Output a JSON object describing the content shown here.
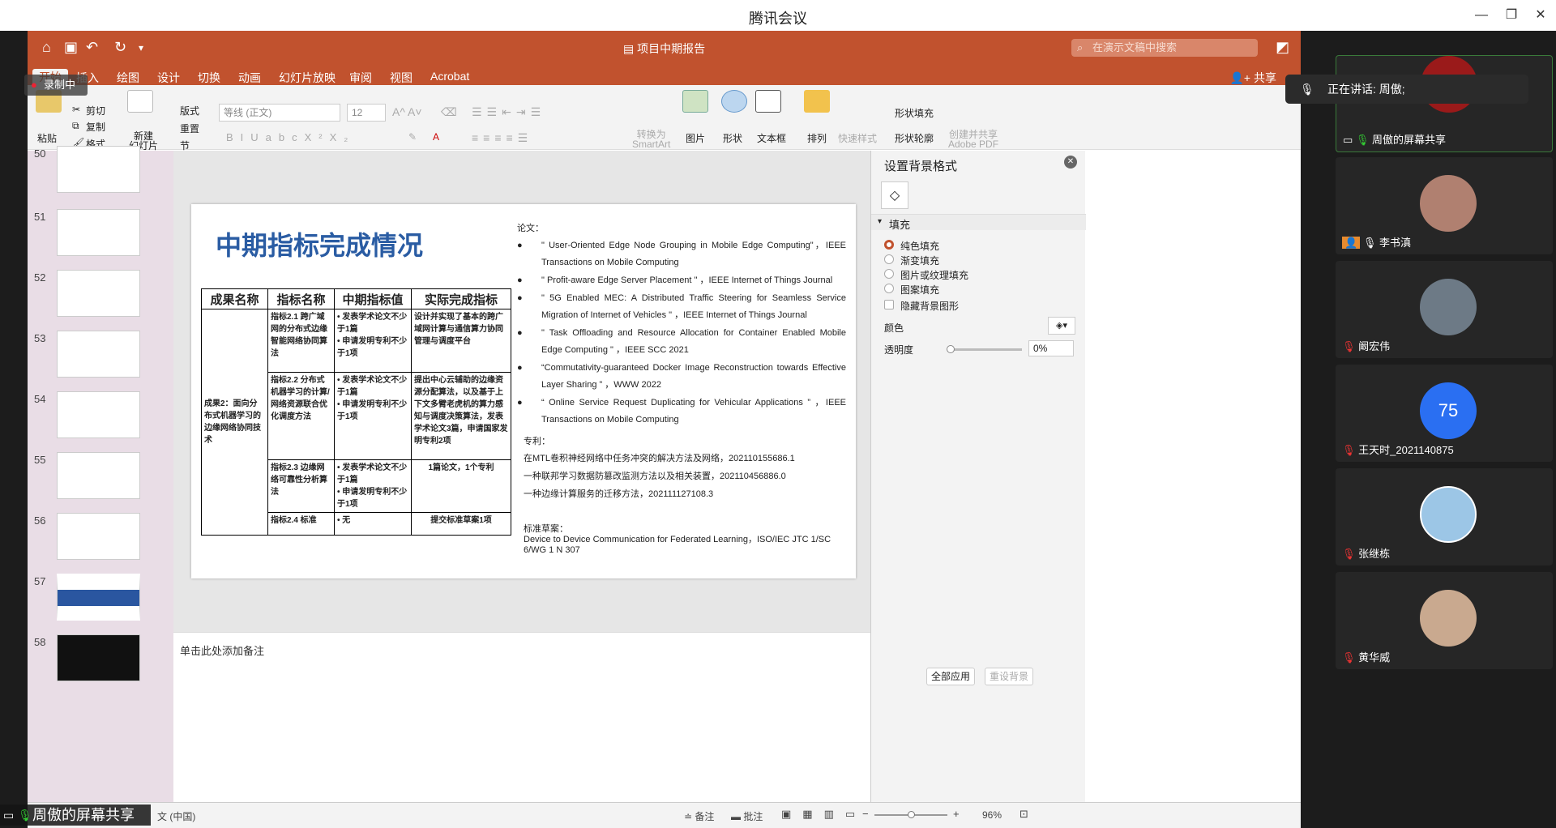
{
  "app": {
    "title": "腾讯会议"
  },
  "ppt": {
    "doc_title": "项目中期报告",
    "search_placeholder": "在演示文稿中搜索",
    "tabs": [
      "开始",
      "插入",
      "绘图",
      "设计",
      "切换",
      "动画",
      "幻灯片放映",
      "审阅",
      "视图",
      "Acrobat"
    ],
    "share_label": "共享",
    "ribbon": {
      "paste": "粘贴",
      "cut": "剪切",
      "copy": "复制",
      "format": "格式",
      "new_slide": "新建\n幻灯片",
      "layout": "版式",
      "reset": "重置",
      "section": "节",
      "font_name": "等线 (正文)",
      "font_size": "12",
      "convert_smartart": "转换为\nSmartArt",
      "picture": "图片",
      "shape": "形状",
      "textbox": "文本框",
      "arrange": "排列",
      "quick_style": "快速样式",
      "shape_fill": "形状填充",
      "shape_outline": "形状轮廓",
      "create_pdf": "创建并共享\nAdobe PDF"
    },
    "slides": [
      {
        "num": "50"
      },
      {
        "num": "51"
      },
      {
        "num": "52"
      },
      {
        "num": "53"
      },
      {
        "num": "54"
      },
      {
        "num": "55"
      },
      {
        "num": "56"
      },
      {
        "num": "57"
      },
      {
        "num": "58"
      }
    ],
    "slide": {
      "title": "中期指标完成情况",
      "table": {
        "headers": [
          "成果名称",
          "指标名称",
          "中期指标值",
          "实际完成指标"
        ],
        "outcome": "成果2：面向分布式机器学习的边缘网络协同技术",
        "rows": [
          {
            "name": "指标2.1 跨广域网的分布式边缘智能网络协同算法",
            "targets": [
              "发表学术论文不少于1篇",
              "申请发明专利不少于1项"
            ],
            "actual": "设计并实现了基本的跨广域网计算与通信算力协同管理与调度平台"
          },
          {
            "name": "指标2.2 分布式机器学习的计算/网络资源联合优化调度方法",
            "targets": [
              "发表学术论文不少于1篇",
              "申请发明专利不少于1项"
            ],
            "actual": "提出中心云辅助的边缘资源分配算法，以及基于上下文多臂老虎机的算力感知与调度决策算法，发表学术论文3篇，申请国家发明专利2项"
          },
          {
            "name": "指标2.3 边缘网络可靠性分析算法",
            "targets": [
              "发表学术论文不少于1篇",
              "申请发明专利不少于1项"
            ],
            "actual": "1篇论文，1个专利"
          },
          {
            "name": "指标2.4 标准",
            "targets": [
              "无"
            ],
            "actual": "提交标准草案1项"
          }
        ]
      },
      "papers_label": "论文：",
      "papers": [
        "\" User-Oriented Edge Node Grouping in Mobile Edge Computing\"，IEEE Transactions on Mobile Computing",
        "\" Profit-aware Edge Server Placement \" ，IEEE Internet of Things Journal",
        "\" 5G Enabled MEC: A Distributed Traffic Steering for Seamless Service Migration of Internet of Vehicles \" ，IEEE Internet of Things Journal",
        "\" Task Offloading and Resource Allocation for Container Enabled Mobile Edge Computing \" ，IEEE SCC 2021",
        "“Commutativity-guaranteed Docker Image Reconstruction towards Effective Layer Sharing ” ，WWW 2022",
        "“ Online Service Request Duplicating for Vehicular Applications ” ，IEEE Transactions on Mobile Computing"
      ],
      "patents_label": "专利：",
      "patents": [
        "在MTL卷积神经网络中任务冲突的解决方法及网络，202110155686.1",
        "一种联邦学习数据防篡改监测方法以及相关装置，202110456886.0",
        "一种边缘计算服务的迁移方法，202111127108.3"
      ],
      "standard_label": "标准草案：",
      "standard": "Device to Device Communication for Federated Learning，ISO/IEC JTC 1/SC 6/WG 1 N 307"
    },
    "notes_placeholder": "单击此处添加备注",
    "format_pane": {
      "title": "设置背景格式",
      "fill_section": "填充",
      "options": [
        "纯色填充",
        "渐变填充",
        "图片或纹理填充",
        "图案填充"
      ],
      "hide_bg": "隐藏背景图形",
      "color_label": "颜色",
      "transparency_label": "透明度",
      "transparency_value": "0%",
      "apply_all": "全部应用",
      "reset_bg": "重设背景"
    },
    "status": {
      "lang": "文 (中国)",
      "notes": "备注",
      "comments": "批注",
      "zoom": "96%"
    }
  },
  "meeting": {
    "recording": "录制中",
    "speaking": "正在讲话: 周傲;",
    "screen_share_indicator": "周傲的屏幕共享",
    "participants": [
      {
        "name": "周傲的屏幕共享"
      },
      {
        "name": "李书滇"
      },
      {
        "name": "阚宏伟"
      },
      {
        "name": "王天时_2021140875",
        "avatar_text": "75"
      },
      {
        "name": "张继栋"
      },
      {
        "name": "黄华威"
      }
    ]
  }
}
